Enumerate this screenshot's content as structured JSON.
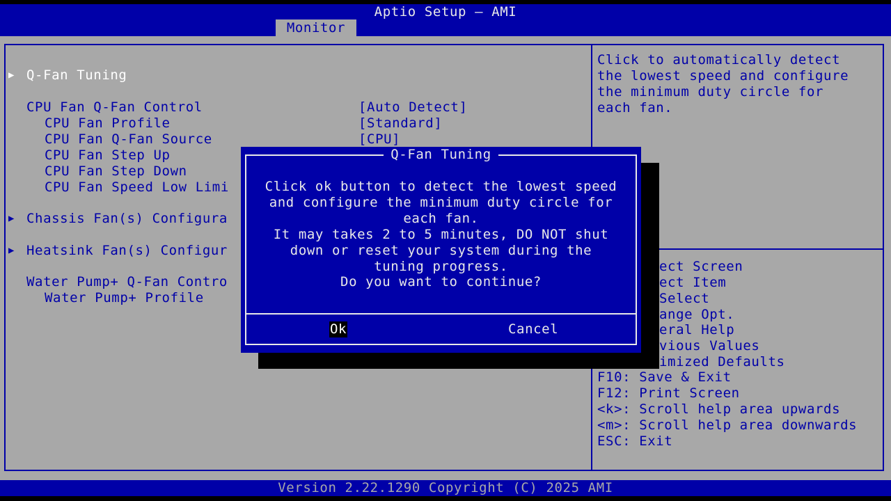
{
  "header": {
    "title": "Aptio Setup – AMI",
    "active_tab": "Monitor"
  },
  "menu": {
    "items": [
      {
        "label": "Q-Fan Tuning",
        "value": "",
        "submenu": true,
        "selected": true
      },
      {
        "label": "CPU Fan Q-Fan Control",
        "value": "[Auto Detect]"
      },
      {
        "label": "CPU Fan Profile",
        "value": "[Standard]"
      },
      {
        "label": "CPU Fan Q-Fan Source",
        "value": "[CPU]"
      },
      {
        "label": "CPU Fan Step Up",
        "value": ""
      },
      {
        "label": "CPU Fan Step Down",
        "value": ""
      },
      {
        "label": "CPU Fan Speed Low Limi",
        "value": ""
      },
      {
        "label": "Chassis Fan(s) Configura",
        "value": "",
        "submenu": true
      },
      {
        "label": "Heatsink Fan(s) Configur",
        "value": "",
        "submenu": true
      },
      {
        "label": "Water Pump+ Q-Fan Contro",
        "value": ""
      },
      {
        "label": "Water Pump+ Profile",
        "value": ""
      }
    ]
  },
  "help": {
    "description": [
      "Click to automatically detect",
      "the lowest speed and configure",
      "the minimum duty circle for",
      "each fan."
    ],
    "keys": [
      "ect Screen",
      "ect Item",
      "Select",
      "ange Opt.",
      "eral Help",
      "vious Values",
      "imized Defaults",
      "F10: Save & Exit",
      "F12: Print Screen",
      "<k>: Scroll help area upwards",
      "<m>: Scroll help area downwards",
      "ESC: Exit"
    ]
  },
  "dialog": {
    "title": "Q-Fan Tuning",
    "message": [
      "Click ok button to detect the lowest speed",
      "and configure the minimum duty circle for",
      "each fan.",
      "It may takes 2 to 5 minutes, DO NOT shut",
      "down or reset your system during the",
      "tuning progress.",
      "Do you want to continue?"
    ],
    "ok_label": "Ok",
    "cancel_label": "Cancel"
  },
  "footer": {
    "version": "Version 2.22.1290 Copyright (C) 2025 AMI"
  },
  "colors": {
    "bios_blue": "#0000a8",
    "bios_gray": "#a8a8a8",
    "text_white": "#e8e8e8"
  },
  "icons": {
    "submenu": "triangle-right-icon"
  }
}
